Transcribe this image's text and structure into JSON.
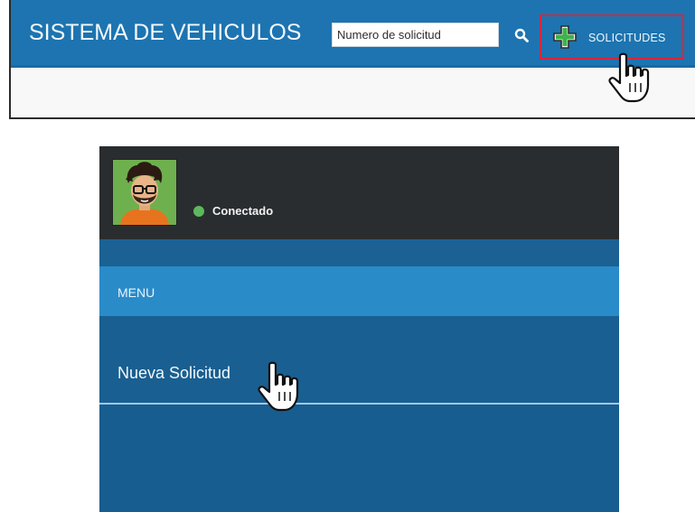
{
  "header": {
    "title": "SISTEMA DE VEHICULOS",
    "search": {
      "placeholder": "Numero de solicitud",
      "value": ""
    },
    "search_icon": "search-icon",
    "solicitudes_label": "SOLICITUDES",
    "solicitudes_icon": "plus-icon",
    "colors": {
      "bar": "#1d74b0",
      "highlight_border": "#d7263d",
      "plus": "#3fb24a"
    }
  },
  "sidebar": {
    "status": "Conectado",
    "status_color": "#5cb85c",
    "menu_header": "MENU",
    "items": [
      {
        "label": "Nueva Solicitud"
      }
    ],
    "colors": {
      "user_area": "#2a2d30",
      "menu_header": "#2a8bc9",
      "body": "#195f91",
      "divider": "#9fc9ea"
    }
  }
}
